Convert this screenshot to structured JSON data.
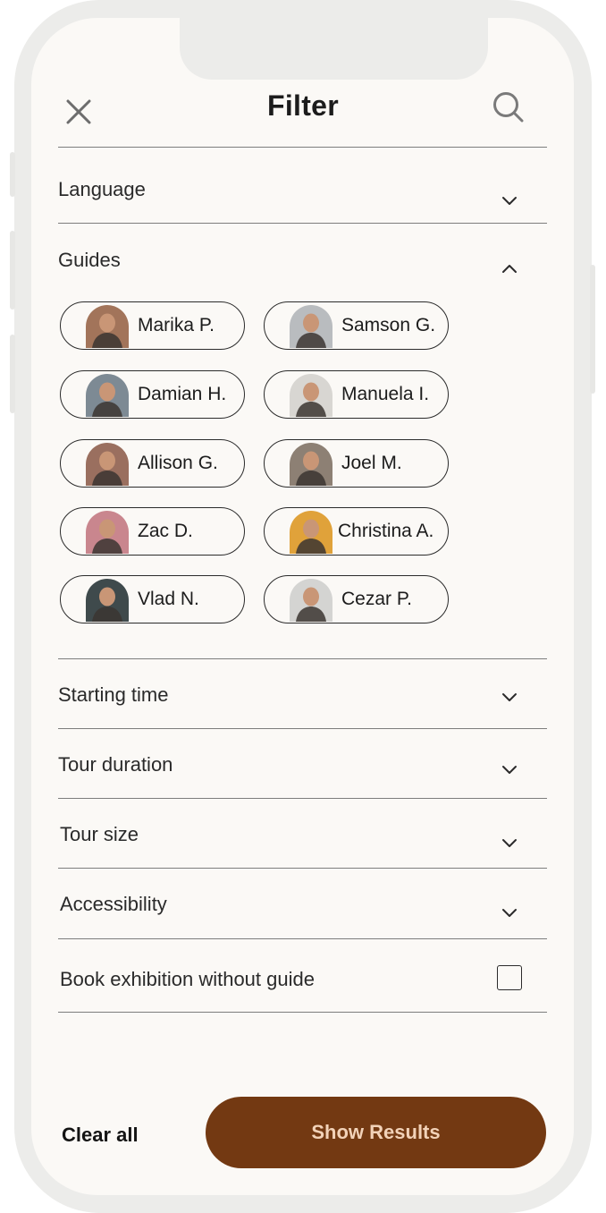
{
  "header": {
    "title": "Filter",
    "close_icon": "close-icon",
    "search_icon": "search-icon"
  },
  "sections": {
    "language": {
      "label": "Language",
      "expanded": false
    },
    "guides": {
      "label": "Guides",
      "expanded": true,
      "items": [
        {
          "name": "Marika P.",
          "avatar_color": "#a2745a"
        },
        {
          "name": "Samson G.",
          "avatar_color": "#b9bcbf"
        },
        {
          "name": "Damian H.",
          "avatar_color": "#7d8a94"
        },
        {
          "name": "Manuela I.",
          "avatar_color": "#d8d6d2"
        },
        {
          "name": "Allison G.",
          "avatar_color": "#9a6f5f"
        },
        {
          "name": "Joel M.",
          "avatar_color": "#8d8074"
        },
        {
          "name": "Zac D.",
          "avatar_color": "#c9868e"
        },
        {
          "name": "Christina A.",
          "avatar_color": "#e0a23a"
        },
        {
          "name": "Vlad N.",
          "avatar_color": "#3f4a4c"
        },
        {
          "name": "Cezar P.",
          "avatar_color": "#d4d4d2"
        }
      ]
    },
    "starting_time": {
      "label": "Starting time",
      "expanded": false
    },
    "tour_duration": {
      "label": "Tour duration",
      "expanded": false
    },
    "tour_size": {
      "label": "Tour size",
      "expanded": false
    },
    "accessibility": {
      "label": "Accessibility",
      "expanded": false
    },
    "book_without_guide": {
      "label": "Book exhibition without guide",
      "checked": false
    }
  },
  "footer": {
    "clear_all": "Clear all",
    "show_results": "Show Results"
  },
  "colors": {
    "background": "#fbf9f6",
    "primary_button": "#733912",
    "primary_button_text": "#f2d2b8",
    "divider": "#7d7d7d"
  }
}
